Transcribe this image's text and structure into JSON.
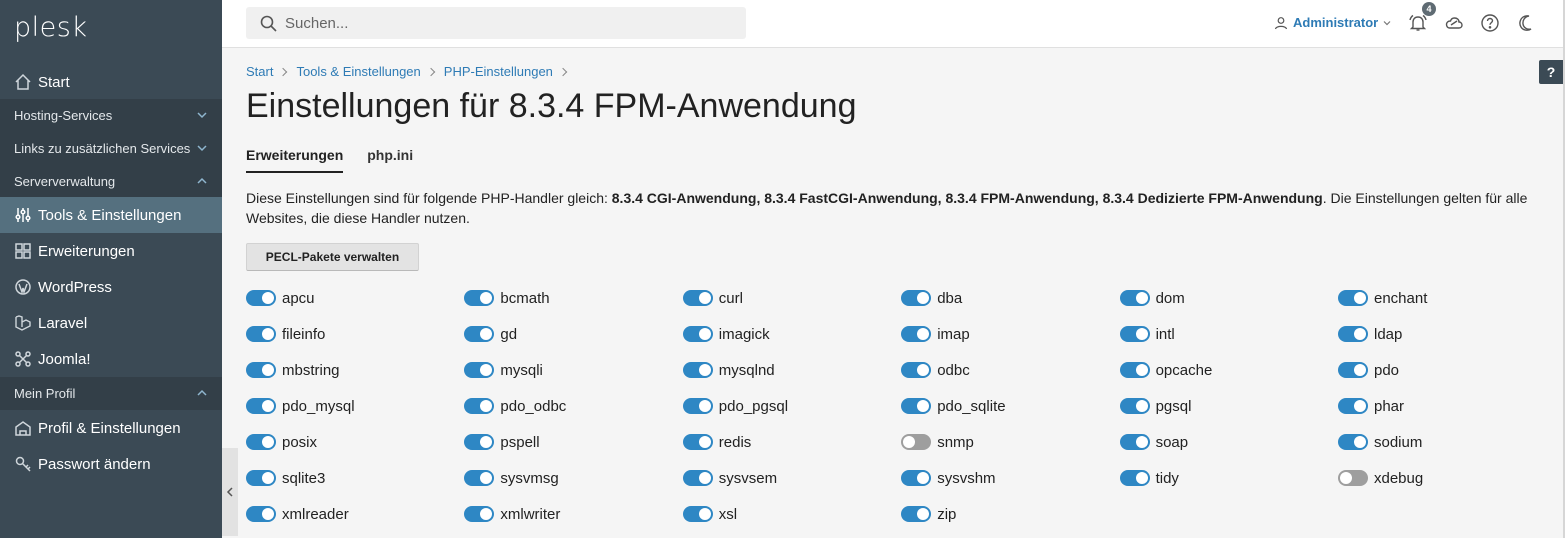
{
  "sidebar": {
    "logo": "plesk",
    "start": "Start",
    "sections": {
      "hosting": "Hosting-Services",
      "links": "Links zu zusätzlichen Services",
      "server": "Serververwaltung",
      "profile": "Mein Profil"
    },
    "items": {
      "tools": "Tools & Einstellungen",
      "extensions": "Erweiterungen",
      "wordpress": "WordPress",
      "laravel": "Laravel",
      "joomla": "Joomla!",
      "profile_settings": "Profil & Einstellungen",
      "password": "Passwort ändern"
    }
  },
  "topbar": {
    "search_placeholder": "Suchen...",
    "user": "Administrator",
    "notification_count": "4"
  },
  "help_label": "?",
  "breadcrumb": [
    "Start",
    "Tools & Einstellungen",
    "PHP-Einstellungen"
  ],
  "page_title": "Einstellungen für 8.3.4 FPM-Anwendung",
  "tabs": [
    "Erweiterungen",
    "php.ini"
  ],
  "description": {
    "prefix": "Diese Einstellungen sind für folgende PHP-Handler gleich: ",
    "handlers": "8.3.4 CGI-Anwendung, 8.3.4 FastCGI-Anwendung, 8.3.4 FPM-Anwendung, 8.3.4 Dedizierte FPM-Anwendung",
    "suffix": ". Die Einstellungen gelten für alle Websites, die diese Handler nutzen."
  },
  "pecl_button": "PECL-Pakete verwalten",
  "extensions": [
    {
      "name": "apcu",
      "enabled": true
    },
    {
      "name": "bcmath",
      "enabled": true
    },
    {
      "name": "curl",
      "enabled": true
    },
    {
      "name": "dba",
      "enabled": true
    },
    {
      "name": "dom",
      "enabled": true
    },
    {
      "name": "enchant",
      "enabled": true
    },
    {
      "name": "fileinfo",
      "enabled": true
    },
    {
      "name": "gd",
      "enabled": true
    },
    {
      "name": "imagick",
      "enabled": true
    },
    {
      "name": "imap",
      "enabled": true
    },
    {
      "name": "intl",
      "enabled": true
    },
    {
      "name": "ldap",
      "enabled": true
    },
    {
      "name": "mbstring",
      "enabled": true
    },
    {
      "name": "mysqli",
      "enabled": true
    },
    {
      "name": "mysqlnd",
      "enabled": true
    },
    {
      "name": "odbc",
      "enabled": true
    },
    {
      "name": "opcache",
      "enabled": true
    },
    {
      "name": "pdo",
      "enabled": true
    },
    {
      "name": "pdo_mysql",
      "enabled": true
    },
    {
      "name": "pdo_odbc",
      "enabled": true
    },
    {
      "name": "pdo_pgsql",
      "enabled": true
    },
    {
      "name": "pdo_sqlite",
      "enabled": true
    },
    {
      "name": "pgsql",
      "enabled": true
    },
    {
      "name": "phar",
      "enabled": true
    },
    {
      "name": "posix",
      "enabled": true
    },
    {
      "name": "pspell",
      "enabled": true
    },
    {
      "name": "redis",
      "enabled": true
    },
    {
      "name": "snmp",
      "enabled": false
    },
    {
      "name": "soap",
      "enabled": true
    },
    {
      "name": "sodium",
      "enabled": true
    },
    {
      "name": "sqlite3",
      "enabled": true
    },
    {
      "name": "sysvmsg",
      "enabled": true
    },
    {
      "name": "sysvsem",
      "enabled": true
    },
    {
      "name": "sysvshm",
      "enabled": true
    },
    {
      "name": "tidy",
      "enabled": true
    },
    {
      "name": "xdebug",
      "enabled": false
    },
    {
      "name": "xmlreader",
      "enabled": true
    },
    {
      "name": "xmlwriter",
      "enabled": true
    },
    {
      "name": "xsl",
      "enabled": true
    },
    {
      "name": "zip",
      "enabled": true
    }
  ],
  "colors": {
    "sidebar": "#3b4a55",
    "sidebar_section": "#333f48",
    "sidebar_active": "#55707f",
    "link": "#2e7bb5",
    "toggle_on": "#2e87c4",
    "toggle_off": "#9e9e9e"
  }
}
